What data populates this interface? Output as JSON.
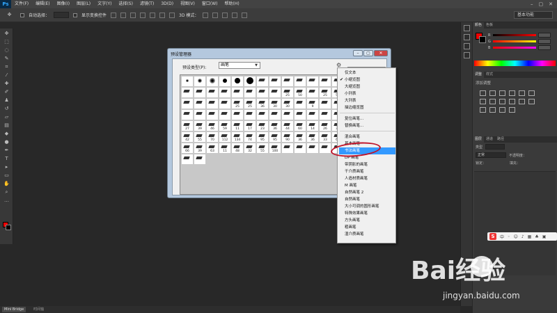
{
  "app": {
    "logo": "Ps"
  },
  "menubar": {
    "items": [
      "文件(F)",
      "编辑(E)",
      "图像(I)",
      "图层(L)",
      "文字(Y)",
      "选择(S)",
      "滤镜(T)",
      "3D(D)",
      "视图(V)",
      "窗口(W)",
      "帮助(H)"
    ]
  },
  "options": {
    "auto_select": "自动选择：",
    "show_transform": "显示变换控件",
    "mode_3d": "3D 模式：",
    "workspace": "基本功能"
  },
  "statusbar": {
    "tabs": [
      "Mini Bridge",
      "时间轴"
    ]
  },
  "panels": {
    "color_tabs": [
      "颜色",
      "色板"
    ],
    "rgb": [
      {
        "label": "R",
        "value": "255"
      },
      {
        "label": "G",
        "value": "0"
      },
      {
        "label": "B",
        "value": "0"
      }
    ],
    "adj_tabs": [
      "调整",
      "样式"
    ],
    "adj_title": "添加调整",
    "layer_tabs": [
      "图层",
      "通道",
      "路径"
    ],
    "kind": "类型",
    "blend": "正常",
    "opacity": "不透明度：",
    "lock": "锁定：",
    "fill": "填充："
  },
  "dialog": {
    "title": "预设管理器",
    "preset_type_label": "预设类型(P):",
    "preset_type_value": "画笔",
    "brush_numbers": [
      "",
      "",
      "",
      "",
      "",
      "",
      "",
      "",
      "",
      "",
      "",
      "",
      "",
      "",
      "",
      "",
      "",
      "",
      "",
      "",
      "",
      "25",
      "50",
      "",
      "25",
      "50",
      "",
      "",
      "",
      "",
      "25",
      "25",
      "36",
      "30",
      "30",
      "",
      "9",
      "",
      "",
      "",
      "",
      "",
      "",
      "",
      "",
      "",
      "",
      "",
      "",
      "",
      "",
      "",
      "27",
      "39",
      "46",
      "59",
      "11",
      "17",
      "23",
      "36",
      "44",
      "60",
      "14",
      "26",
      "33",
      "42",
      "55",
      "70",
      "112",
      "134",
      "74",
      "95",
      "95",
      "90",
      "36",
      "36",
      "33",
      "63",
      "66",
      "39",
      "63",
      "11",
      "48",
      "32",
      "55",
      "100",
      "",
      "",
      "",
      "",
      "",
      "",
      ""
    ]
  },
  "context_menu": {
    "checked": "小缩览图",
    "group1": [
      "仅文本",
      "小缩览图",
      "大缩览图",
      "小列表",
      "大列表",
      "描边缩览图"
    ],
    "group2": [
      "复位画笔...",
      "替换画笔..."
    ],
    "group3": [
      "混合画笔",
      "基本画笔",
      "书法画笔",
      "DP 画笔",
      "带阴影的画笔",
      "干介质画笔",
      "人造材质画笔",
      "M 画笔",
      "自然画笔 2",
      "自然画笔",
      "大小可调的圆形画笔",
      "特殊效果画笔",
      "方头画笔",
      "粗画笔",
      "湿介质画笔"
    ],
    "highlighted": "书法画笔"
  },
  "ime": {
    "logo": "S",
    "text": "中"
  },
  "watermark": {
    "brand": "Bai经验",
    "url": "jingyan.baidu.com"
  },
  "colors": {
    "accent": "#3399ff",
    "circle": "#c0142a",
    "foreground": "#ee0000",
    "background": "#000000"
  }
}
